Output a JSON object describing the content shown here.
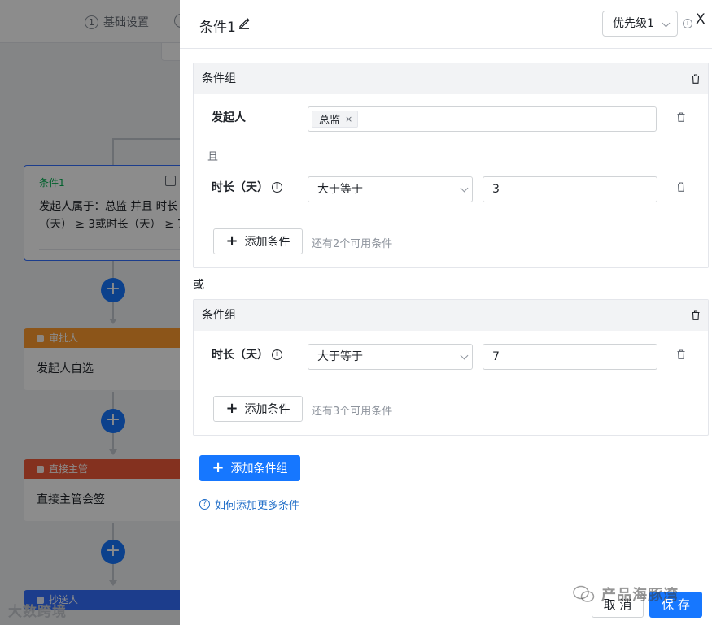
{
  "background": {
    "steps": [
      {
        "num": "1",
        "label": "基础设置"
      }
    ],
    "condition_card": {
      "title": "条件1",
      "text_line1": "发起人属于：总监 并且 时长",
      "text_line2": "（天） ≥ 3或时长（天） ≥ 7"
    },
    "nodes": [
      {
        "head": "审批人",
        "body": "发起人自选"
      },
      {
        "head": "直接主管",
        "body": "直接主管会签"
      },
      {
        "head": "抄送人"
      }
    ],
    "add_symbol": "+",
    "watermark_left": "大数跨境"
  },
  "drawer": {
    "title": "条件1",
    "priority": "优先级1",
    "info_mark": "i",
    "close": "X",
    "or_label": "或",
    "groups": [
      {
        "title": "条件组",
        "rows": [
          {
            "label": "发起人",
            "tag": "总监",
            "tag_close": "×"
          },
          {
            "label": "时长（天）",
            "operator": "大于等于",
            "value": "3"
          }
        ],
        "and_label": "且",
        "add_condition": "添加条件",
        "hint": "还有2个可用条件"
      },
      {
        "title": "条件组",
        "rows": [
          {
            "label": "时长（天）",
            "operator": "大于等于",
            "value": "7"
          }
        ],
        "add_condition": "添加条件",
        "hint": "还有3个可用条件"
      }
    ],
    "add_group": "添加条件组",
    "help_link": "如何添加更多条件",
    "help_mark": "?",
    "footer": {
      "cancel": "取 消",
      "save": "保 存"
    },
    "watermark_right": "产品海豚湾"
  }
}
